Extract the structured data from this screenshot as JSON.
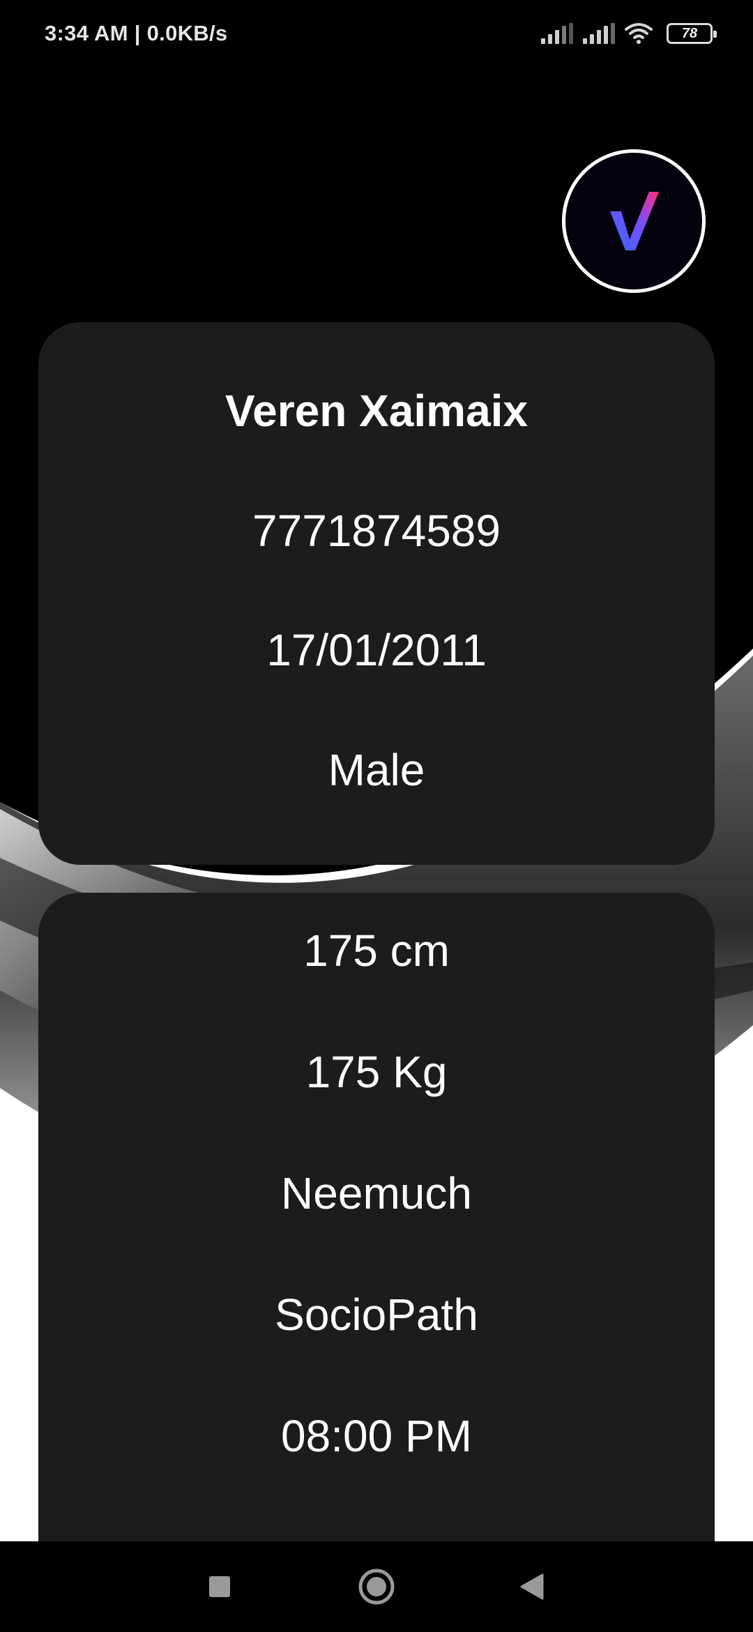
{
  "status_bar": {
    "time_speed": "3:34 AM | 0.0KB/s",
    "battery_level": "78"
  },
  "profile": {
    "name": "Veren Xaimaix",
    "phone": "7771874589",
    "dob": "17/01/2011",
    "gender": "Male"
  },
  "details": {
    "height": "175 cm",
    "weight": "175 Kg",
    "city": "Neemuch",
    "trait": "SocioPath",
    "time": "08:00 PM"
  },
  "icons": {
    "avatar": "v-logo-icon",
    "nav_recent": "square-icon",
    "nav_home": "circle-icon",
    "nav_back": "triangle-back-icon"
  },
  "colors": {
    "background_dark": "#000000",
    "card": "#1c1c1c",
    "logo_blue": "#2f6bff",
    "logo_pink": "#ff2f7a"
  }
}
